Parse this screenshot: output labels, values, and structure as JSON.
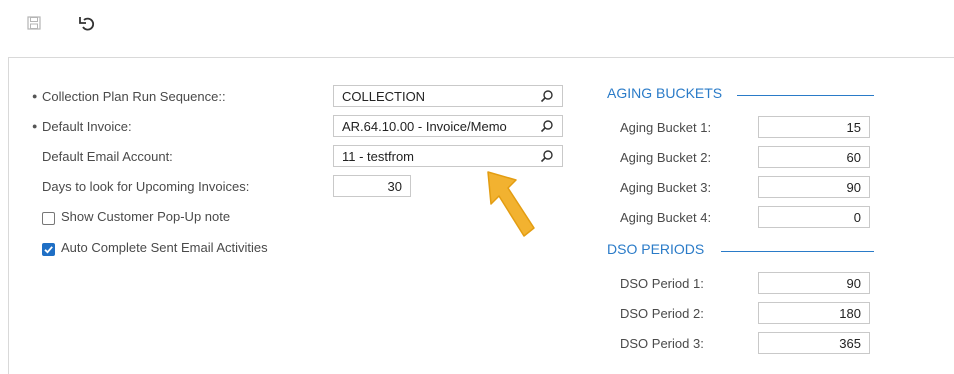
{
  "toolbar": {
    "save_icon": "save-icon",
    "undo_icon": "undo-icon"
  },
  "left": {
    "collection_plan": {
      "label": "Collection Plan Run Sequence::",
      "value": "COLLECTION",
      "required": true
    },
    "default_invoice": {
      "label": "Default Invoice:",
      "value": "AR.64.10.00 - Invoice/Memo",
      "required": true
    },
    "default_email": {
      "label": "Default Email Account:",
      "value": "11 - testfrom"
    },
    "days_upcoming": {
      "label": "Days to look for Upcoming Invoices:",
      "value": "30"
    },
    "show_popup": {
      "label": "Show Customer Pop-Up note",
      "checked": false
    },
    "auto_complete": {
      "label": "Auto Complete Sent Email Activities",
      "checked": true
    }
  },
  "aging": {
    "title": "AGING BUCKETS",
    "items": [
      {
        "label": "Aging Bucket 1:",
        "value": "15"
      },
      {
        "label": "Aging Bucket 2:",
        "value": "60"
      },
      {
        "label": "Aging Bucket 3:",
        "value": "90"
      },
      {
        "label": "Aging Bucket 4:",
        "value": "0"
      }
    ]
  },
  "dso": {
    "title": "DSO PERIODS",
    "items": [
      {
        "label": "DSO Period 1:",
        "value": "90"
      },
      {
        "label": "DSO Period 2:",
        "value": "180"
      },
      {
        "label": "DSO Period 3:",
        "value": "365"
      }
    ]
  },
  "colors": {
    "accent": "#2a7bc8",
    "checkbox": "#1f6fc5",
    "arrow": "#f2b230"
  },
  "annotation": {
    "icon": "arrow-pointer-icon"
  }
}
